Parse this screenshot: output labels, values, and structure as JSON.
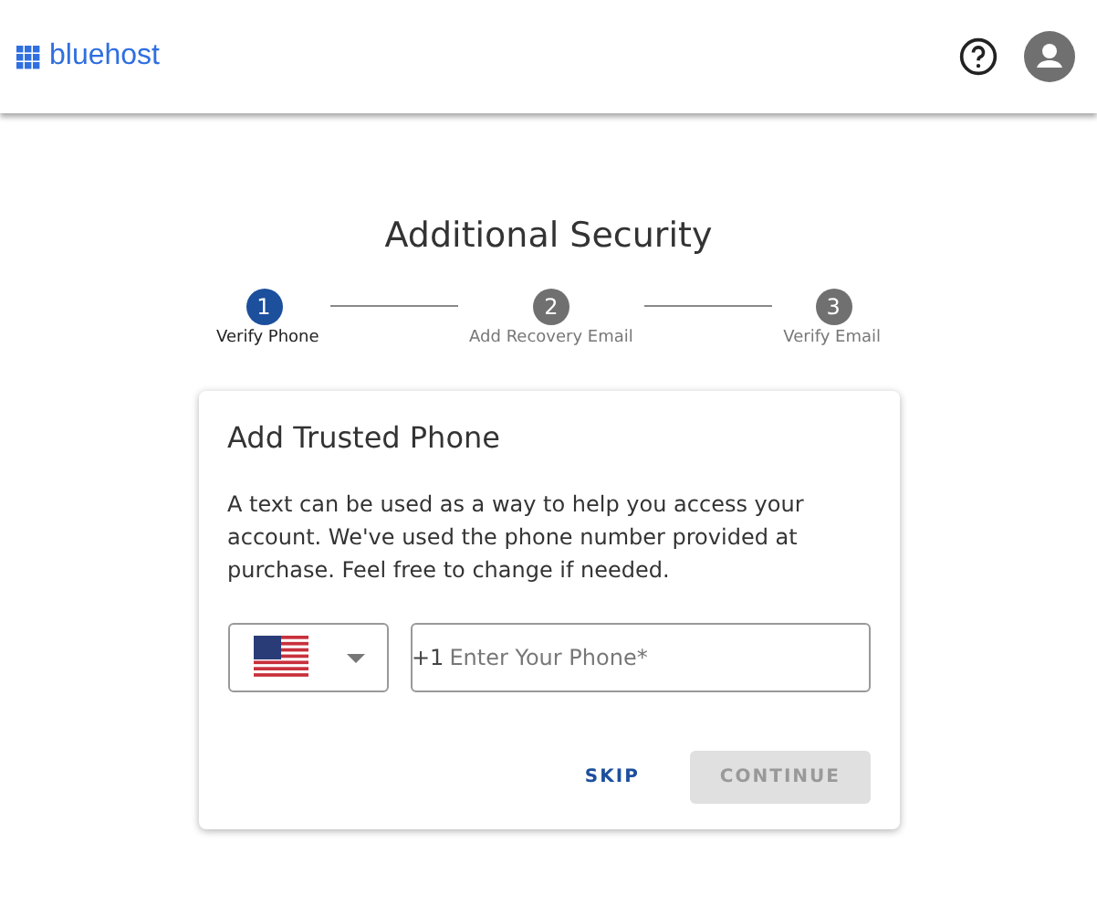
{
  "header": {
    "logo": "bluehost"
  },
  "title": "Additional Security",
  "steps": [
    {
      "number": "1",
      "label": "Verify Phone",
      "selected": true
    },
    {
      "number": "2",
      "label": "Add Recovery Email",
      "selected": false
    },
    {
      "number": "3",
      "label": "Verify Email",
      "selected": false
    }
  ],
  "card": {
    "heading": "Add Trusted Phone",
    "text": "A text can be used as a way to help you access your account. We've used the phone number provided at purchase. Feel free to change if needed.",
    "prefix": "+1",
    "placeholder": "Enter Your Phone*",
    "buttons": [
      {
        "label": "SKIP",
        "kind": "text",
        "disabled": false
      },
      {
        "label": "CONTINUE",
        "kind": "filled",
        "disabled": true
      }
    ]
  }
}
